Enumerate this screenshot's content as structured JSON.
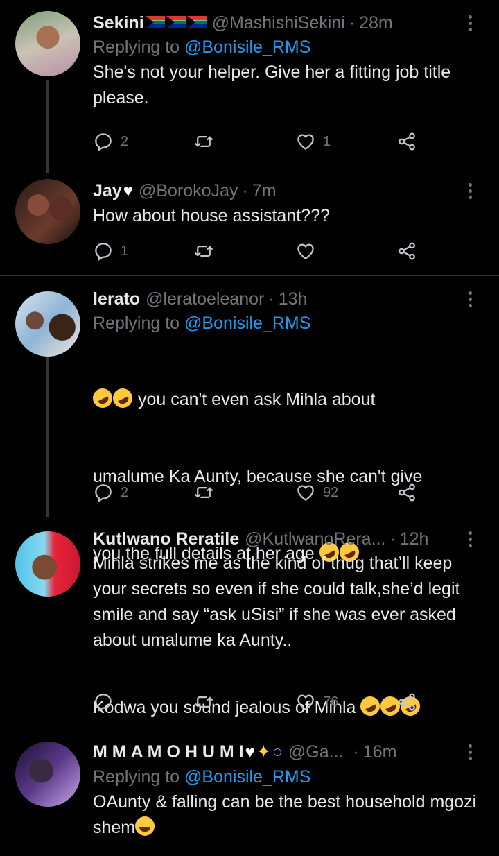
{
  "tweets": [
    {
      "name": "Sekini",
      "name_suffix_flags": 3,
      "handle": "@MashishiSekini",
      "time": "28m",
      "replying_label": "Replying to",
      "replying_to": "@Bonisile_RMS",
      "text": "She's not your helper. Give her a fitting job title please.",
      "replies": "2",
      "retweets": "",
      "likes": "1"
    },
    {
      "name": "Jay",
      "handle": "@BorokoJay",
      "time": "7m",
      "text": "How about house assistant???",
      "replies": "1",
      "retweets": "",
      "likes": ""
    },
    {
      "name": "lerato",
      "handle": "@leratoeleanor",
      "time": "13h",
      "replying_label": "Replying to",
      "replying_to": "@Bonisile_RMS",
      "text_line1": " you can't even ask Mihla about",
      "text_line2": "umalume Ka Aunty, because she can't give",
      "text_line3": "you the full details at her age ",
      "text_line4": "Kodwa you sound jealous of Mihla ",
      "replies": "2",
      "retweets": "",
      "likes": "92"
    },
    {
      "name": "Kutlwano Reratile",
      "handle": "@KutlwanoRera...",
      "time": "12h",
      "text": "Mihla strikes me as the kind of thug that’ll keep your secrets so even if she could talk,she’d legit smile and say “ask uSisi” if she was ever asked about umalume ka Aunty..",
      "replies": "",
      "retweets": "",
      "likes": "76"
    },
    {
      "name": "M M A M O H U M I",
      "handle": "@Ga...",
      "time": "16m",
      "replying_label": "Replying to",
      "replying_to": "@Bonisile_RMS",
      "text": "OAunty & falling can be the best household mgozi shem"
    }
  ],
  "colors": {
    "mention": "#1d9bf0",
    "muted": "#71767b",
    "divider": "#2f3336",
    "background": "#000000"
  },
  "icons": [
    "reply-icon",
    "retweet-icon",
    "like-icon",
    "share-icon",
    "more-icon"
  ]
}
